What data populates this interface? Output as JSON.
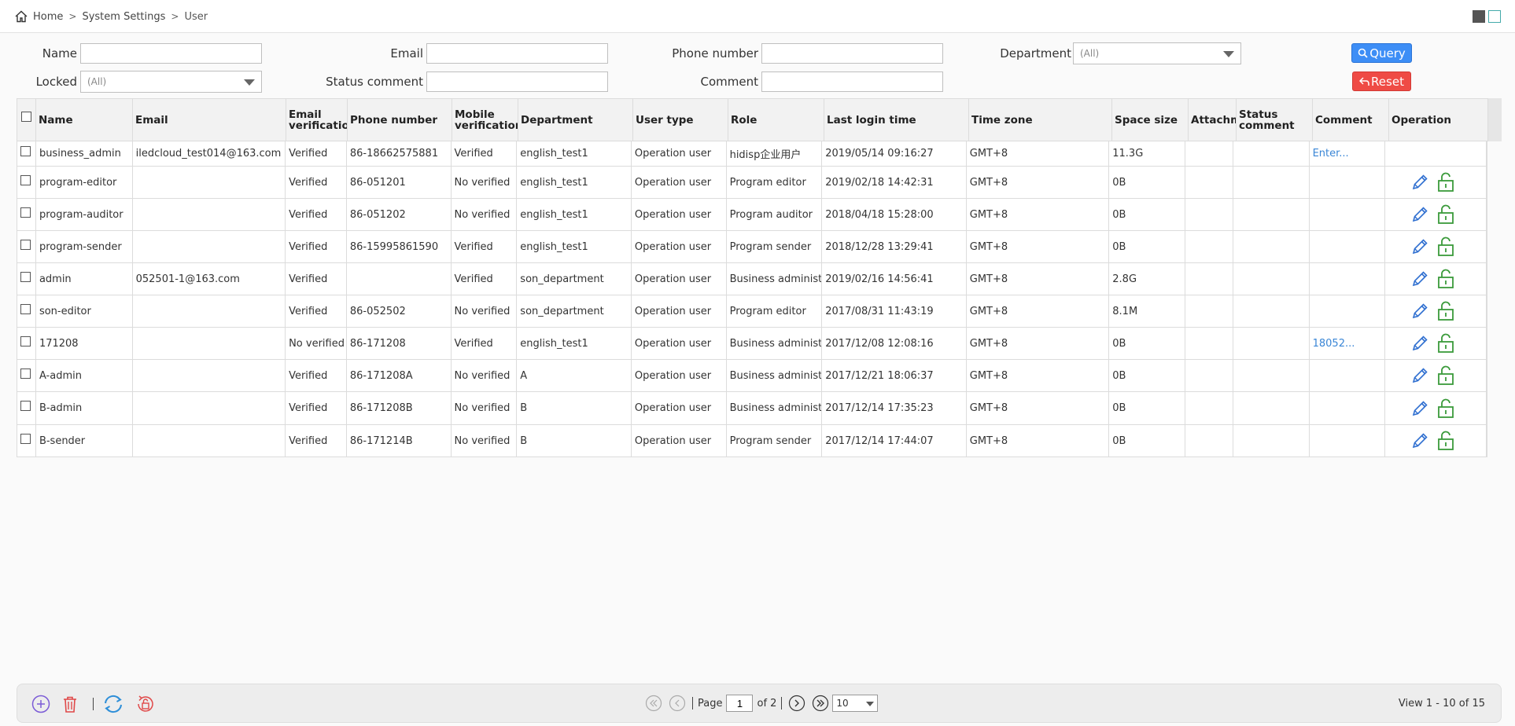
{
  "breadcrumb": {
    "home": "Home",
    "section": "System Settings",
    "current": "User"
  },
  "filters": {
    "name_label": "Name",
    "name_value": "",
    "email_label": "Email",
    "email_value": "",
    "phone_label": "Phone number",
    "phone_value": "",
    "department_label": "Department",
    "department_value": "(All)",
    "locked_label": "Locked",
    "locked_value": "(All)",
    "status_comment_label": "Status comment",
    "status_comment_value": "",
    "comment_label": "Comment",
    "comment_value": "",
    "query_label": "Query",
    "reset_label": "Reset"
  },
  "table": {
    "headers": [
      "Name",
      "Email",
      "Email verification",
      "Phone number",
      "Mobile verification",
      "Department",
      "User type",
      "Role",
      "Last login time",
      "Time zone",
      "Space size",
      "Attachm",
      "Status comment",
      "Comment",
      "Operation"
    ],
    "rows": [
      [
        "business_admin",
        "iledcloud_test014@163.com",
        "Verified",
        "86-18662575881",
        "Verified",
        "english_test1",
        "Operation user",
        "hidisp企业用户",
        "2019/05/14 09:16:27",
        "GMT+8",
        "11.3G",
        "",
        "",
        "Enter..."
      ],
      [
        "program-editor",
        "",
        "Verified",
        "86-051201",
        "No verified",
        "english_test1",
        "Operation user",
        "Program editor",
        "2019/02/18 14:42:31",
        "GMT+8",
        "0B",
        "",
        "",
        ""
      ],
      [
        "program-auditor",
        "",
        "Verified",
        "86-051202",
        "No verified",
        "english_test1",
        "Operation user",
        "Program auditor",
        "2018/04/18 15:28:00",
        "GMT+8",
        "0B",
        "",
        "",
        ""
      ],
      [
        "program-sender",
        "",
        "Verified",
        "86-15995861590",
        "Verified",
        "english_test1",
        "Operation user",
        "Program sender",
        "2018/12/28 13:29:41",
        "GMT+8",
        "0B",
        "",
        "",
        ""
      ],
      [
        "admin",
        "052501-1@163.com",
        "Verified",
        "",
        "Verified",
        "son_department",
        "Operation user",
        "Business administrator",
        "2019/02/16 14:56:41",
        "GMT+8",
        "2.8G",
        "",
        "",
        ""
      ],
      [
        "son-editor",
        "",
        "Verified",
        "86-052502",
        "No verified",
        "son_department",
        "Operation user",
        "Program editor",
        "2017/08/31 11:43:19",
        "GMT+8",
        "8.1M",
        "",
        "",
        ""
      ],
      [
        "171208",
        "",
        "No verified",
        "86-171208",
        "Verified",
        "english_test1",
        "Operation user",
        "Business administrator",
        "2017/12/08 12:08:16",
        "GMT+8",
        "0B",
        "",
        "",
        "18052..."
      ],
      [
        "A-admin",
        "",
        "Verified",
        "86-171208A",
        "No verified",
        "A",
        "Operation user",
        "Business administrator",
        "2017/12/21 18:06:37",
        "GMT+8",
        "0B",
        "",
        "",
        ""
      ],
      [
        "B-admin",
        "",
        "Verified",
        "86-171208B",
        "No verified",
        "B",
        "Operation user",
        "Business administrator",
        "2017/12/14 17:35:23",
        "GMT+8",
        "0B",
        "",
        "",
        ""
      ],
      [
        "B-sender",
        "",
        "Verified",
        "86-171214B",
        "No verified",
        "B",
        "Operation user",
        "Program sender",
        "2017/12/14 17:44:07",
        "GMT+8",
        "0B",
        "",
        "",
        ""
      ]
    ],
    "row_has_operations": [
      false,
      true,
      true,
      true,
      true,
      true,
      true,
      true,
      true,
      true
    ],
    "comment_link_rows": [
      0,
      6
    ]
  },
  "pager": {
    "page_label": "Page",
    "page_value": "1",
    "of_label": "of 2",
    "page_size": "10",
    "view_info": "View 1 - 10 of 15"
  },
  "icons": {
    "home": "home-icon",
    "add": "add-icon",
    "delete": "trash-icon",
    "refresh": "refresh-icon",
    "unlock_all": "unlock-icon",
    "edit": "pencil-icon",
    "unlock": "unlock-icon",
    "query": "search-icon",
    "reset": "reply-icon"
  },
  "colors": {
    "primary": "#3d8ef6",
    "danger": "#ef4b45",
    "success": "#3a9a3a",
    "link": "#3a86d6",
    "purple": "#7b5bd6"
  }
}
